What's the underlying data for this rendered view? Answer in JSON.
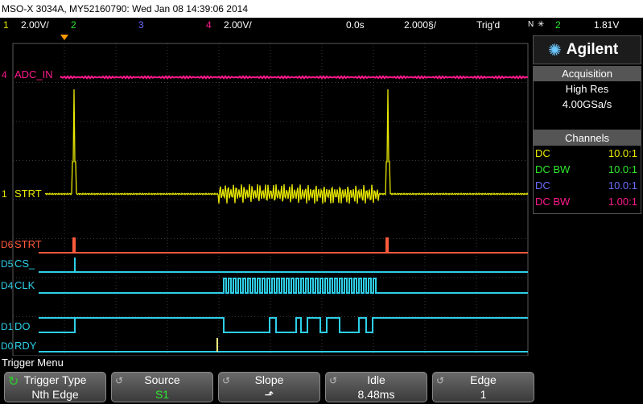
{
  "title": "MSO-X 3034A, MY52160790: Wed Jan 08 14:39:06 2014",
  "status": {
    "ch1_num": "1",
    "ch1_scale": "2.00V/",
    "ch2_num": "2",
    "ch3_num": "3",
    "ch4_num": "4",
    "ch4_scale": "2.00V/",
    "delay": "0.0s",
    "timebase": "2.000§/",
    "trig_mode": "Trig'd",
    "trig_src": "N",
    "trig_ch": "2",
    "trig_level": "1.81V"
  },
  "labels": {
    "adc": "ADC_IN",
    "strt_analog": "STRT",
    "d6_tag": "D6",
    "d6": "STRT",
    "d5_tag": "D5",
    "d5": "CS_",
    "d4_tag": "D4",
    "d4": "CLK",
    "d1_tag": "D1",
    "d1": "DO",
    "d0_tag": "D0",
    "d0": "RDY",
    "ch4_marker": "4",
    "ch1_marker": "1"
  },
  "sidebar": {
    "brand": "Agilent",
    "acq_header": "Acquisition",
    "acq_mode": "High Res",
    "acq_rate": "4.00GSa/s",
    "ch_header": "Channels",
    "channels": [
      {
        "coupling": "DC",
        "probe": "10.0:1",
        "color": "#e8e800"
      },
      {
        "coupling": "DC BW",
        "probe": "10.0:1",
        "color": "#2ee82e"
      },
      {
        "coupling": "DC",
        "probe": "10.0:1",
        "color": "#6c6cff"
      },
      {
        "coupling": "DC BW",
        "probe": "1.00:1",
        "color": "#ff1a8c"
      }
    ]
  },
  "menu": {
    "title": "Trigger Menu",
    "keys": [
      {
        "title": "Trigger Type",
        "value": "Nth Edge"
      },
      {
        "title": "Source",
        "value": "S1"
      },
      {
        "title": "Slope",
        "value": "⬏"
      },
      {
        "title": "Idle",
        "value": "8.48ms"
      },
      {
        "title": "Edge",
        "value": "1"
      }
    ]
  },
  "colors": {
    "ch1": "#e8e800",
    "ch2": "#2ee82e",
    "ch3": "#6c6cff",
    "ch4": "#ff1a8c",
    "digital": "#2ecfe8",
    "d6": "#ff5a3c"
  }
}
